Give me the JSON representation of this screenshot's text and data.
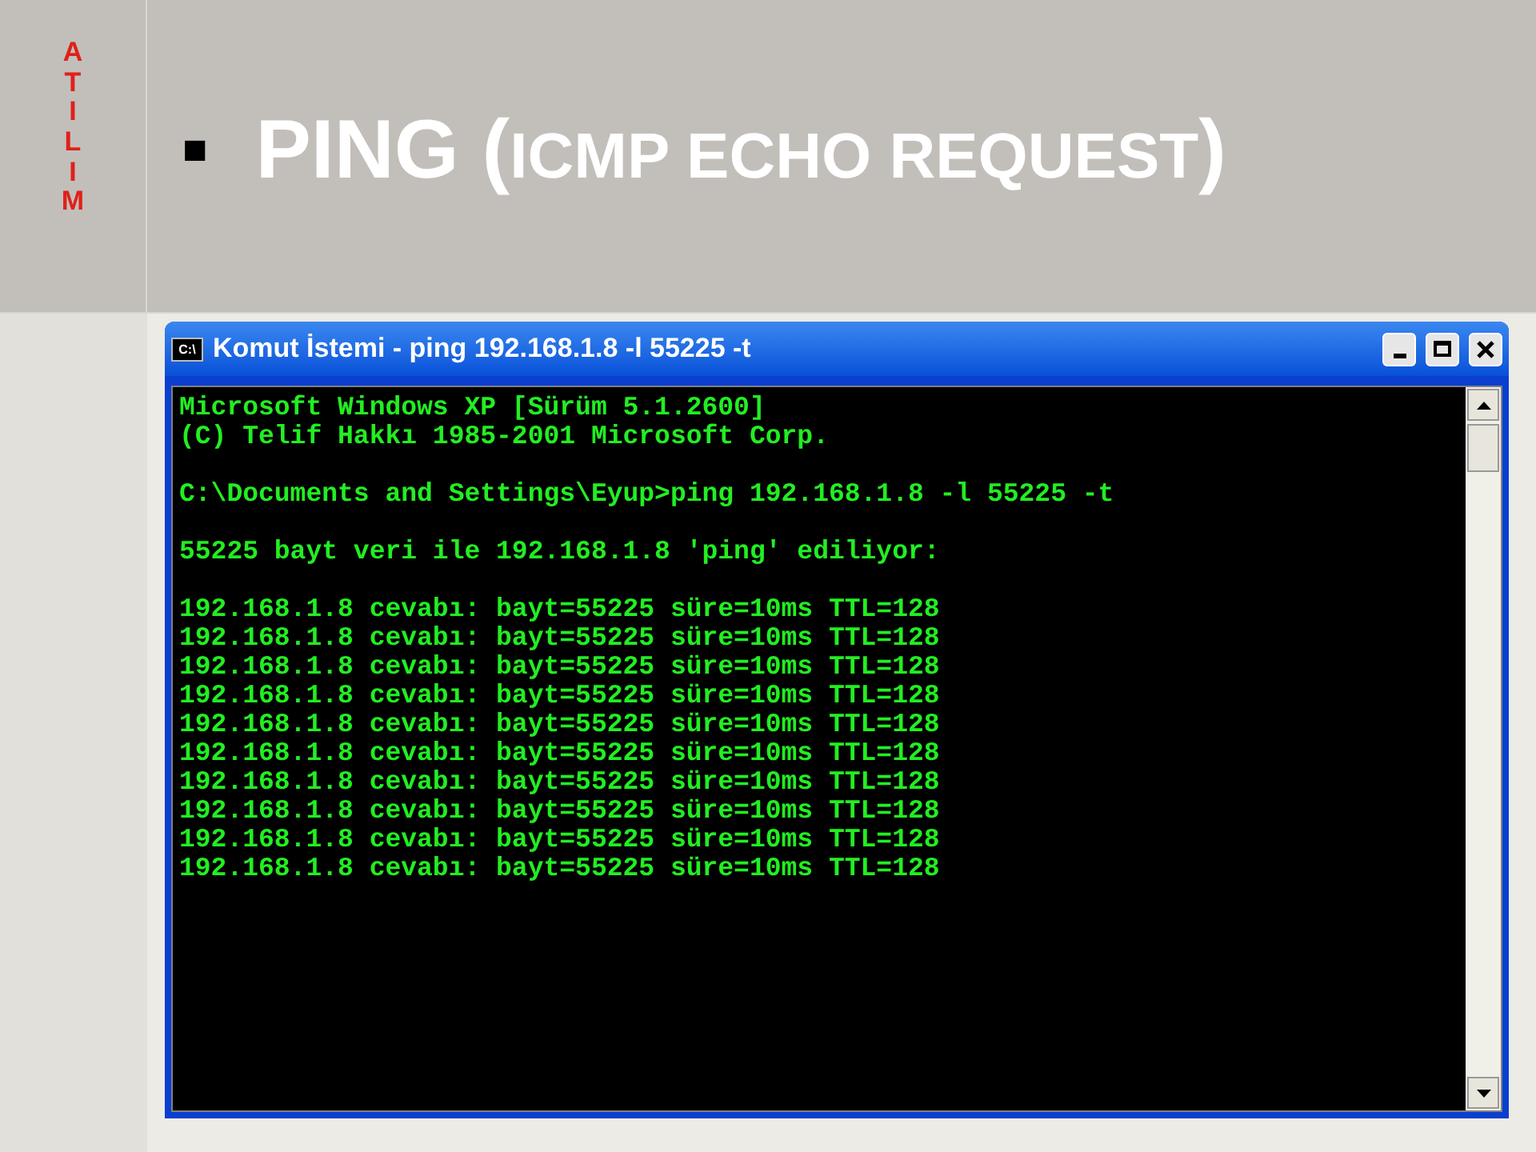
{
  "logo": {
    "letters": "ATILIM"
  },
  "title": {
    "bullet": "■",
    "parts": [
      {
        "text": "PING (",
        "small": false
      },
      {
        "text": "ICMP ECHO REQUEST",
        "small": true
      },
      {
        "text": ")",
        "small": false
      }
    ]
  },
  "window": {
    "title": "Komut İstemi - ping 192.168.1.8 -l 55225 -t",
    "icon": "C:\\",
    "console": [
      [
        "Microsoft Windows XP [Sürüm 5.1.2600]",
        "(C) Telif Hakkı 1985-2001 Microsoft Corp."
      ],
      [
        "C:\\Documents and Settings\\Eyup>ping 192.168.1.8 -l 55225 -t"
      ],
      [
        "55225 bayt veri ile 192.168.1.8 'ping' ediliyor:"
      ],
      [
        "192.168.1.8 cevabı: bayt=55225 süre=10ms TTL=128",
        "192.168.1.8 cevabı: bayt=55225 süre=10ms TTL=128",
        "192.168.1.8 cevabı: bayt=55225 süre=10ms TTL=128",
        "192.168.1.8 cevabı: bayt=55225 süre=10ms TTL=128",
        "192.168.1.8 cevabı: bayt=55225 süre=10ms TTL=128",
        "192.168.1.8 cevabı: bayt=55225 süre=10ms TTL=128",
        "192.168.1.8 cevabı: bayt=55225 süre=10ms TTL=128",
        "192.168.1.8 cevabı: bayt=55225 süre=10ms TTL=128",
        "192.168.1.8 cevabı: bayt=55225 süre=10ms TTL=128",
        "192.168.1.8 cevabı: bayt=55225 süre=10ms TTL=128"
      ]
    ]
  }
}
